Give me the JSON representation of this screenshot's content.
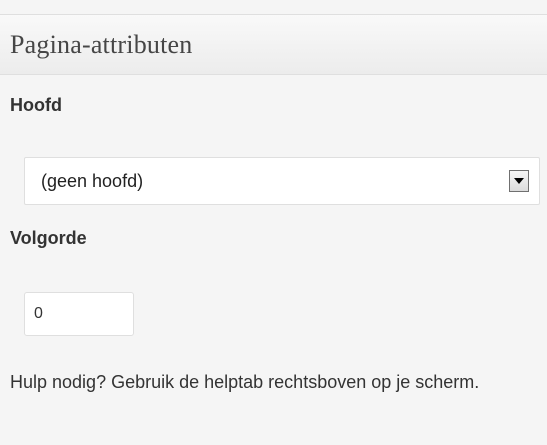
{
  "panel": {
    "title": "Pagina-attributen"
  },
  "parent": {
    "label": "Hoofd",
    "selected": "(geen hoofd)"
  },
  "order": {
    "label": "Volgorde",
    "value": "0"
  },
  "help": {
    "text": "Hulp nodig? Gebruik de helptab rechtsboven op je scherm."
  },
  "icons": {
    "dropdown": "chevron-down-icon"
  }
}
